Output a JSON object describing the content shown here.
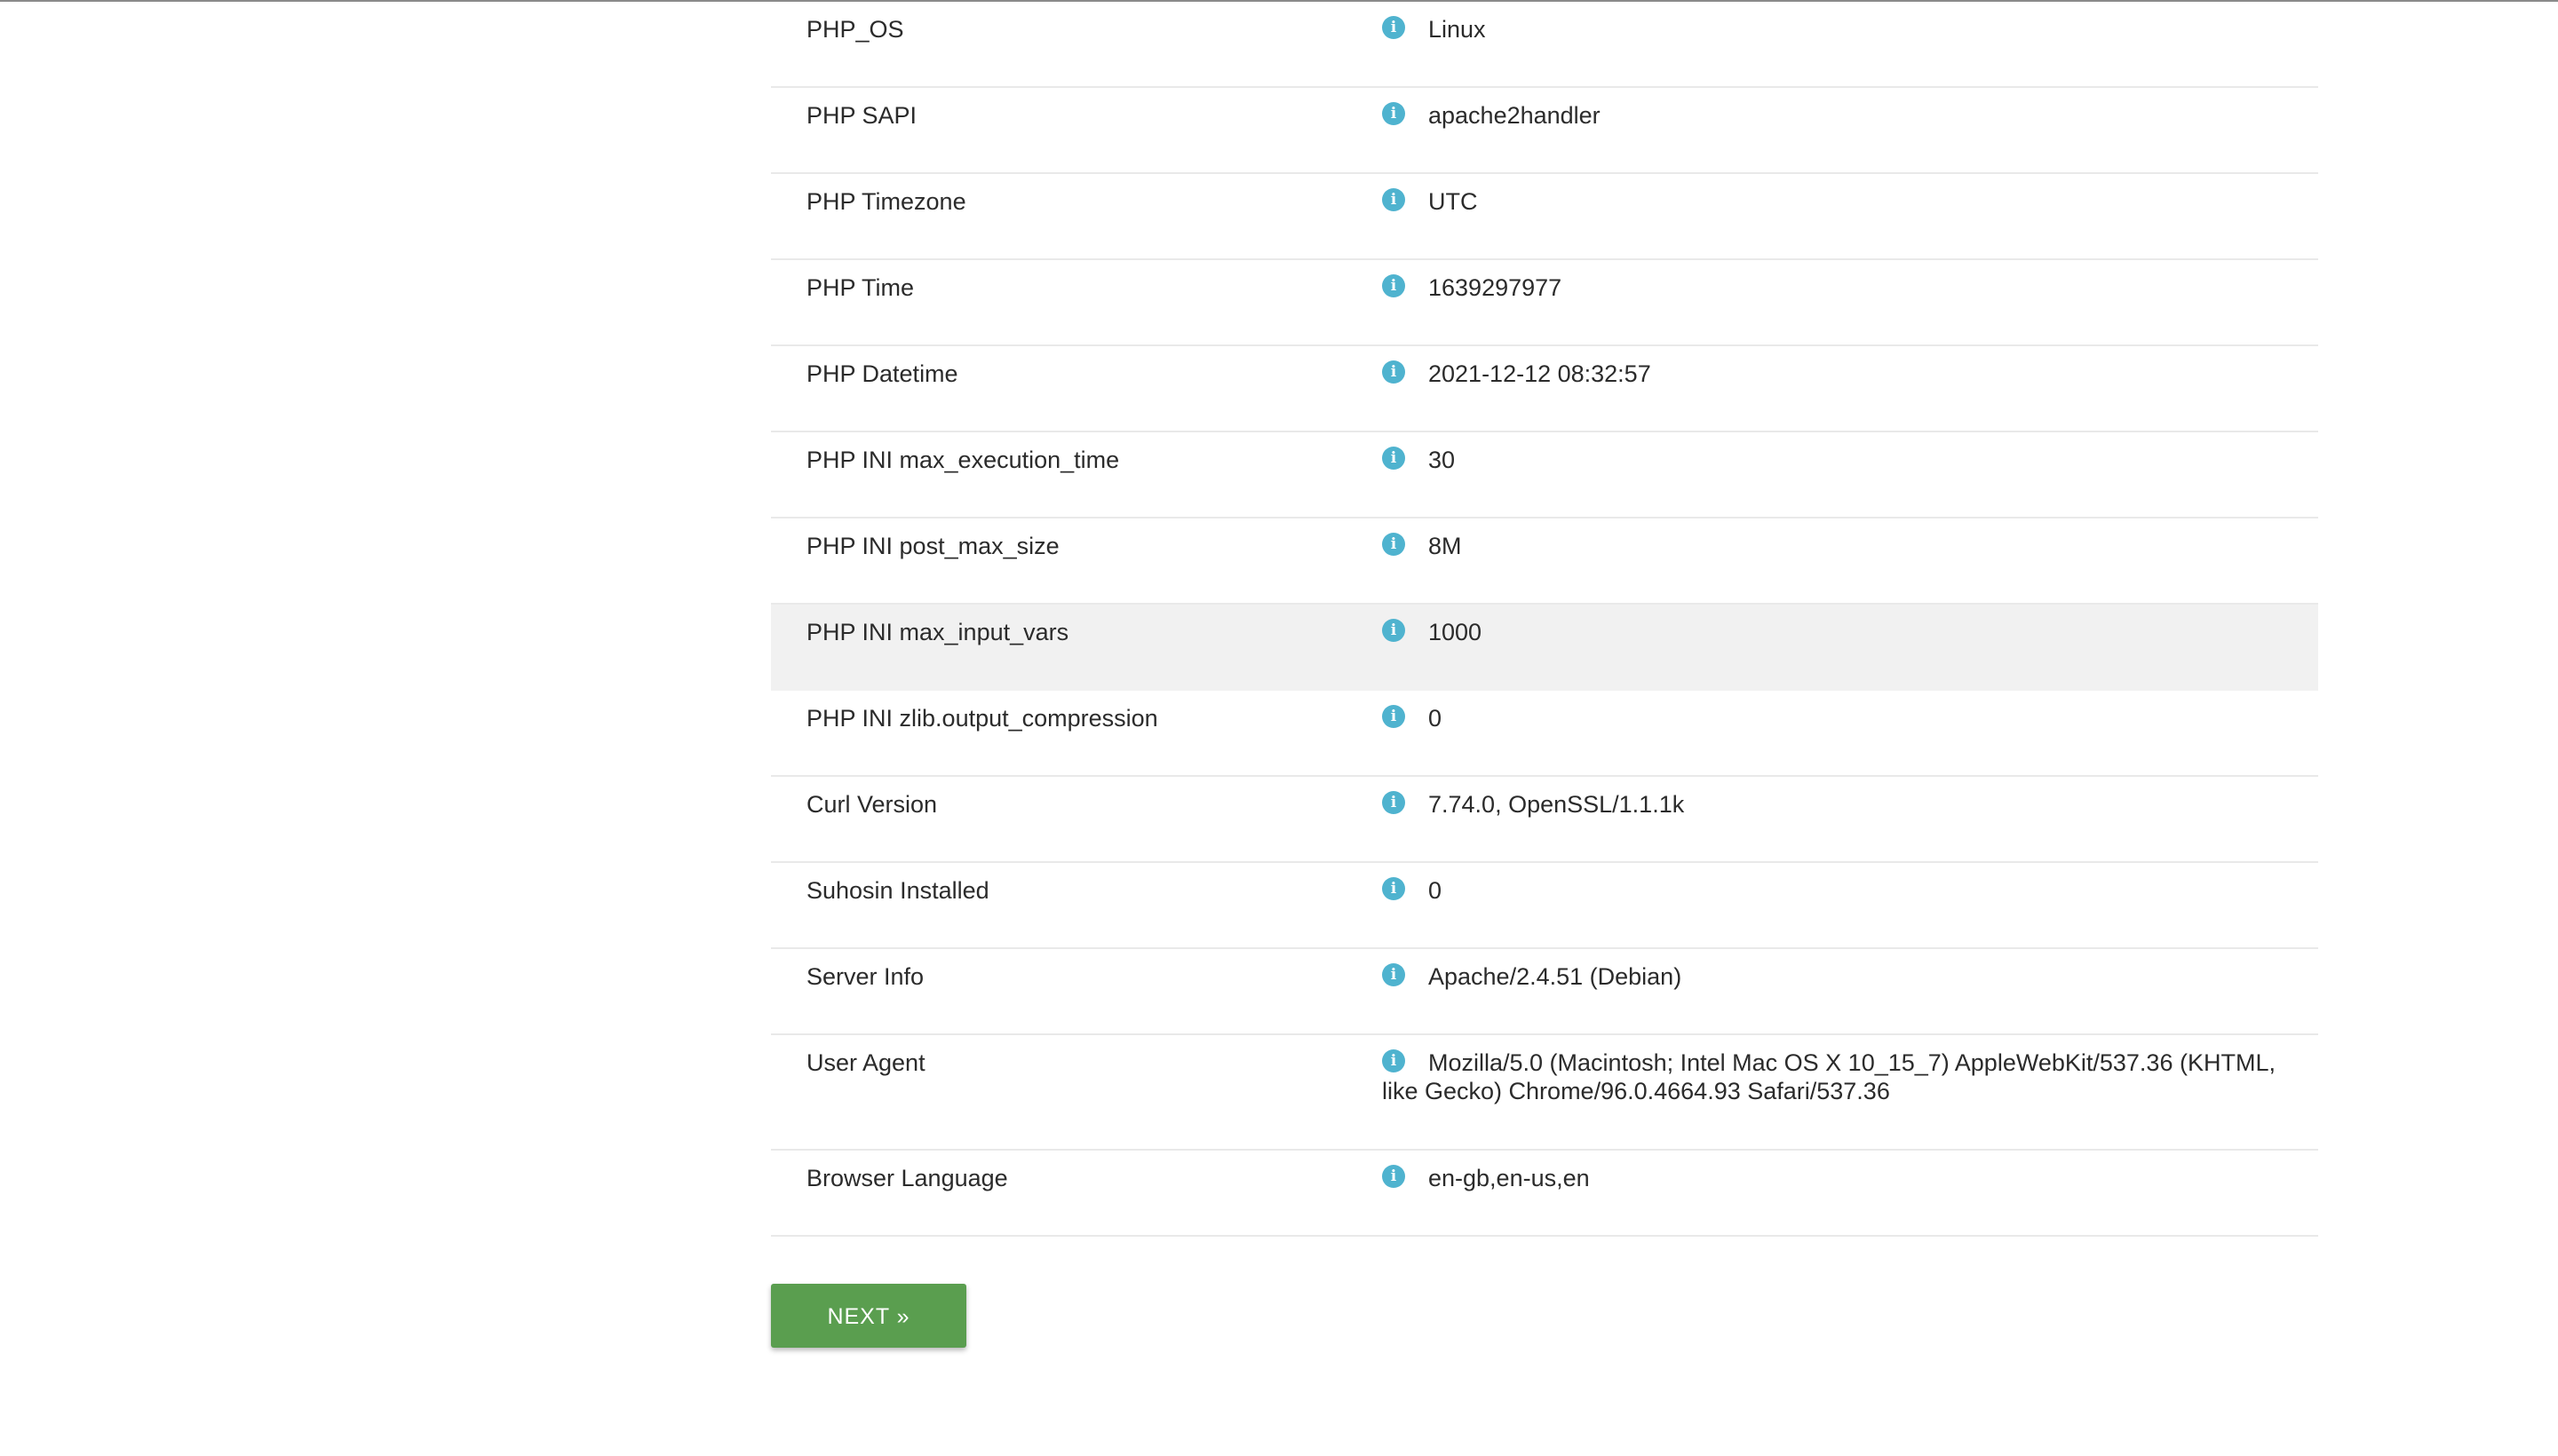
{
  "rows": [
    {
      "label": "PHP_OS",
      "value": "Linux"
    },
    {
      "label": "PHP SAPI",
      "value": "apache2handler"
    },
    {
      "label": "PHP Timezone",
      "value": "UTC"
    },
    {
      "label": "PHP Time",
      "value": "1639297977"
    },
    {
      "label": "PHP Datetime",
      "value": "2021-12-12 08:32:57"
    },
    {
      "label": "PHP INI max_execution_time",
      "value": "30"
    },
    {
      "label": "PHP INI post_max_size",
      "value": "8M"
    },
    {
      "label": "PHP INI max_input_vars",
      "value": "1000"
    },
    {
      "label": "PHP INI zlib.output_compression",
      "value": "0"
    },
    {
      "label": "Curl Version",
      "value": "7.74.0, OpenSSL/1.1.1k"
    },
    {
      "label": "Suhosin Installed",
      "value": "0"
    },
    {
      "label": "Server Info",
      "value": "Apache/2.4.51 (Debian)"
    },
    {
      "label": "User Agent",
      "value": "Mozilla/5.0 (Macintosh; Intel Mac OS X 10_15_7) AppleWebKit/537.36 (KHTML, like Gecko) Chrome/96.0.4664.93 Safari/537.36"
    },
    {
      "label": "Browser Language",
      "value": "en-gb,en-us,en"
    }
  ],
  "info_icon": {
    "name": "info-icon",
    "glyph": "i",
    "color": "#4fb3cf"
  },
  "next_button": {
    "label": "NEXT »",
    "color": "#5a9e4f"
  }
}
